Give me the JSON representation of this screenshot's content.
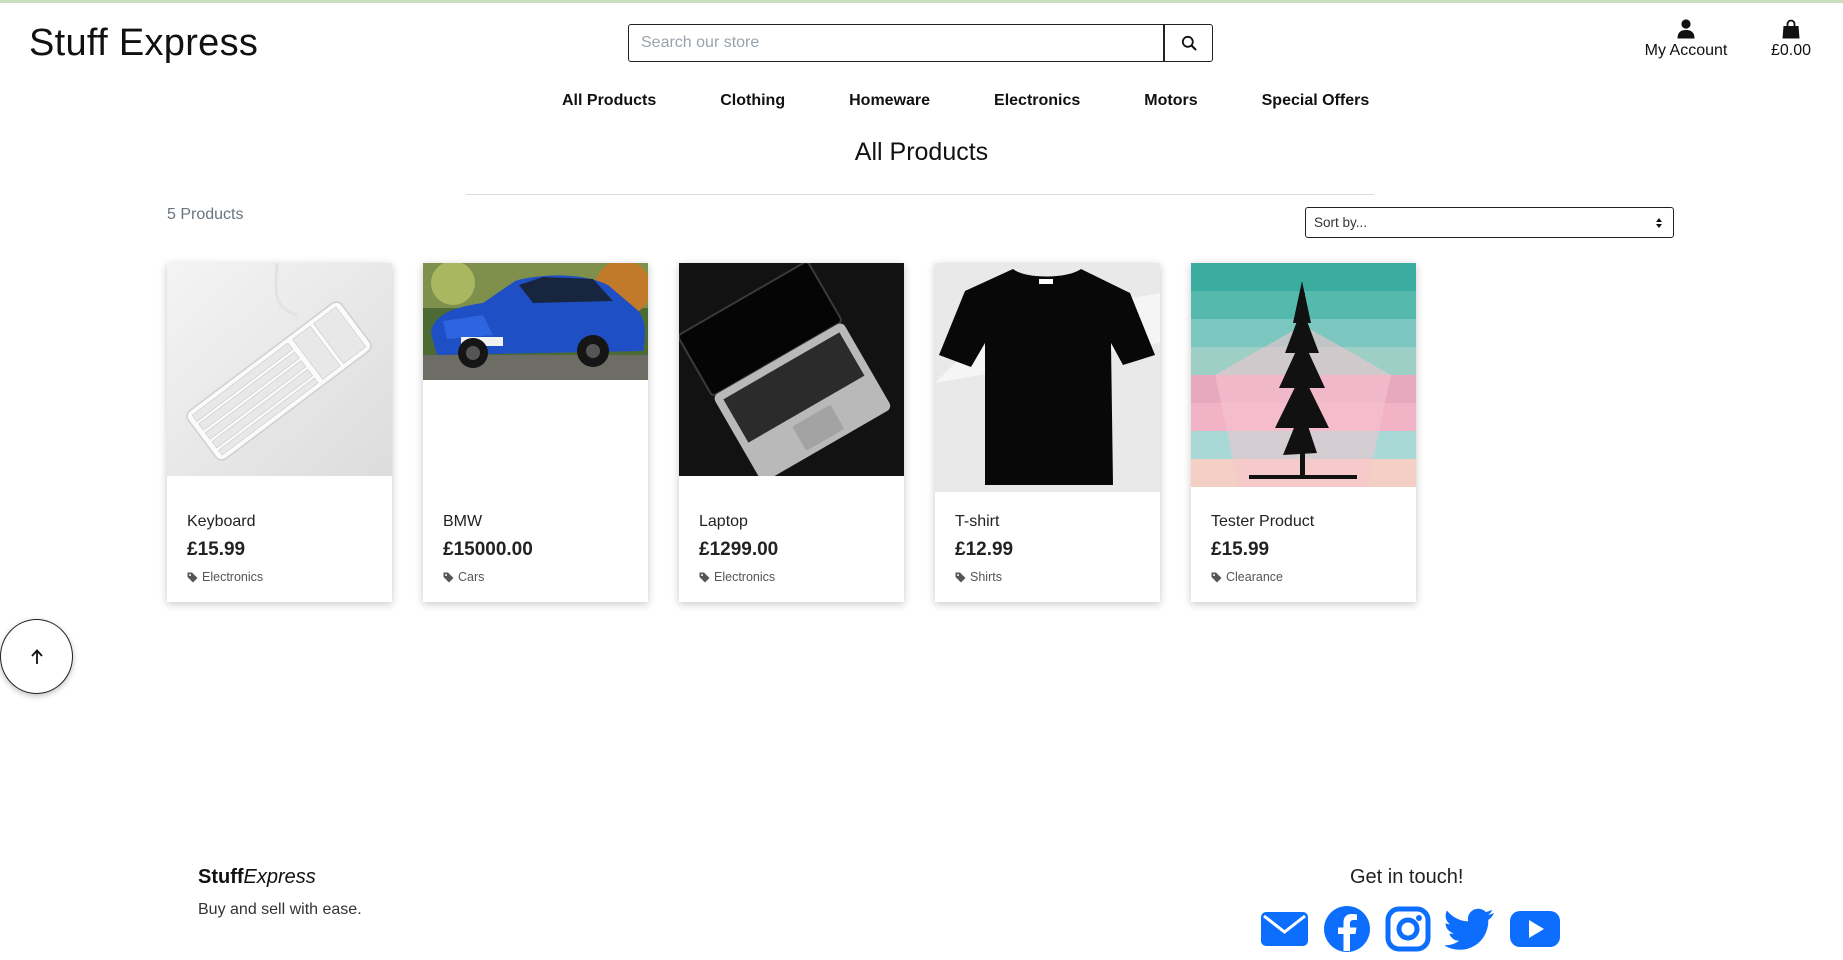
{
  "brand": "Stuff Express",
  "search": {
    "placeholder": "Search our store"
  },
  "header": {
    "account_label": "My Account",
    "bag_total": "£0.00"
  },
  "nav": [
    "All Products",
    "Clothing",
    "Homeware",
    "Electronics",
    "Motors",
    "Special Offers"
  ],
  "page_title": "All Products",
  "product_count": "5 Products",
  "sort": {
    "selected": "Sort by..."
  },
  "products": [
    {
      "name": "Keyboard",
      "price": "£15.99",
      "category": "Electronics"
    },
    {
      "name": "BMW",
      "price": "£15000.00",
      "category": "Cars"
    },
    {
      "name": "Laptop",
      "price": "£1299.00",
      "category": "Electronics"
    },
    {
      "name": "T-shirt",
      "price": "£12.99",
      "category": "Shirts"
    },
    {
      "name": "Tester Product",
      "price": "£15.99",
      "category": "Clearance"
    }
  ],
  "footer": {
    "brand_bold": "Stuff",
    "brand_italic": "Express",
    "tagline": "Buy and sell with ease.",
    "cta": "Get in touch!",
    "socials": [
      "envelope-icon",
      "facebook-icon",
      "instagram-icon",
      "twitter-icon",
      "youtube-icon"
    ]
  },
  "colors": {
    "social_blue": "#0d6efd",
    "top_strip": "#c9dfc2"
  }
}
